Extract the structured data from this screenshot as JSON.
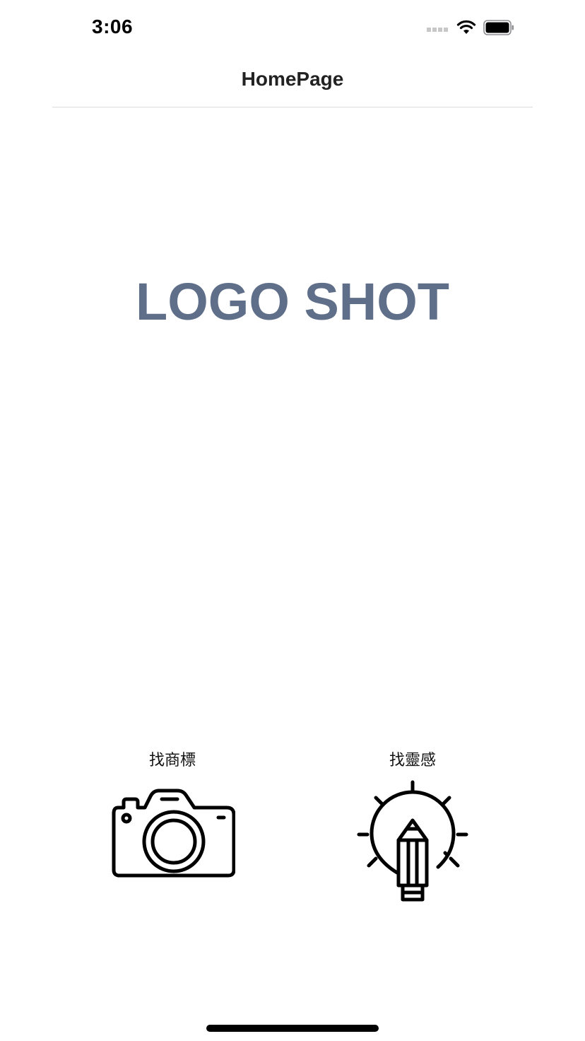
{
  "status_bar": {
    "time": "3:06",
    "icons": [
      "signal-icon",
      "wifi-icon",
      "battery-icon"
    ]
  },
  "nav": {
    "title": "HomePage"
  },
  "logo": {
    "text": "LOGO SHOT",
    "color": "#5f6f89"
  },
  "actions": [
    {
      "label": "找商標",
      "icon": "camera-icon"
    },
    {
      "label": "找靈感",
      "icon": "lightbulb-pencil-icon"
    }
  ]
}
